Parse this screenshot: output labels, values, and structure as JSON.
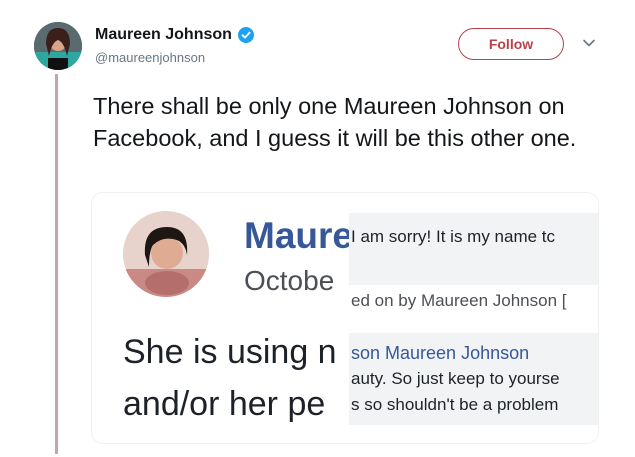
{
  "tweet": {
    "author": {
      "display_name": "Maureen Johnson",
      "handle": "@maureenjohnson",
      "verified": true
    },
    "follow_label": "Follow",
    "text": "There shall be only one Maureen Johnson on Facebook, and I guess it will be this other one."
  },
  "media": {
    "left": {
      "name_fragment": "Maure",
      "date_fragment": "Octobe",
      "line1_fragment": "She is using n",
      "line2_fragment": "and/or her pe"
    },
    "right": {
      "line1": "I am sorry! It is my name tc",
      "line2": "ed on by Maureen Johnson [",
      "line3": "son Maureen Johnson",
      "line4": "auty. So just keep to yourse",
      "line5": "s so shouldn't be a problem"
    }
  },
  "colors": {
    "follow_border": "#b4434a",
    "verified_blue": "#1da1f2",
    "thread_line": "#c9a3a8",
    "facebook_blue": "#365899"
  }
}
